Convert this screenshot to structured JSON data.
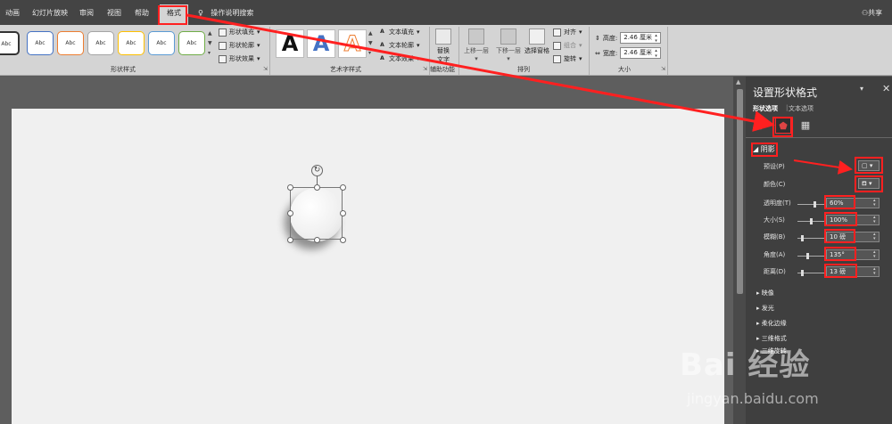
{
  "tabs": [
    {
      "label": "动画"
    },
    {
      "label": "幻灯片放映"
    },
    {
      "label": "审阅"
    },
    {
      "label": "视图"
    },
    {
      "label": "帮助"
    },
    {
      "label": "格式"
    }
  ],
  "tell_me": "操作说明搜索",
  "share": "共享",
  "ribbon": {
    "shape_styles": {
      "sample_text": "Abc",
      "count": 7,
      "fill": "形状填充",
      "outline": "形状轮廓",
      "effects": "形状效果",
      "group_label": "形状样式"
    },
    "wordart": {
      "letter": "A",
      "text_fill": "文本填充",
      "text_outline": "文本轮廓",
      "text_effects": "文本效果",
      "group_label": "艺术字样式"
    },
    "accessibility": {
      "alt_text_line1": "替换",
      "alt_text_line2": "文字",
      "group_label": "辅助功能"
    },
    "arrange": {
      "bring_forward": "上移一层",
      "send_backward": "下移一层",
      "selection_pane": "选择窗格",
      "align": "对齐",
      "group": "组合",
      "rotate": "旋转",
      "group_label": "排列"
    },
    "size": {
      "height_label": "高度:",
      "height_value": "2.46 厘米",
      "width_label": "宽度:",
      "width_value": "2.46 厘米",
      "group_label": "大小"
    }
  },
  "panel": {
    "title": "设置形状格式",
    "tab_shape": "形状选项",
    "tab_text": "文本选项",
    "section_shadow": "阴影",
    "props": {
      "preset_label": "预设(P)",
      "color_label": "颜色(C)",
      "transparency_label": "透明度(T)",
      "transparency_value": "60%",
      "size_label": "大小(S)",
      "size_value": "100%",
      "blur_label": "模糊(B)",
      "blur_value": "10 磅",
      "angle_label": "角度(A)",
      "angle_value": "135°",
      "distance_label": "距离(D)",
      "distance_value": "13 磅"
    },
    "collapsed_sections": [
      "映像",
      "发光",
      "柔化边缘",
      "三维格式",
      "三维旋转"
    ]
  },
  "watermark": {
    "main": "Bai 经验",
    "url": "jingyan.baidu.com"
  },
  "colors": {
    "annotation": "#ff2020",
    "panel_bg": "#3f3f3f",
    "ribbon_bg": "#d4d4d4"
  }
}
